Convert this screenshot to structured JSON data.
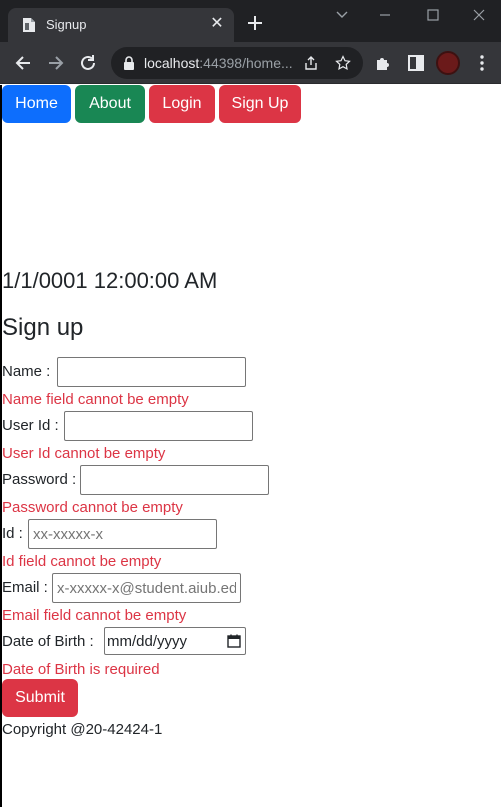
{
  "browser": {
    "tab_title": "Signup",
    "url_host": "localhost",
    "url_rest": ":44398/home..."
  },
  "nav": {
    "home": "Home",
    "about": "About",
    "login": "Login",
    "signup": "Sign Up"
  },
  "page": {
    "datetime": "1/1/0001 12:00:00 AM",
    "heading": "Sign up",
    "copyright": "Copyright @20-42424-1"
  },
  "form": {
    "name_label": "Name :",
    "name_value": "",
    "name_error": "Name field cannot be empty",
    "userid_label": "User Id :",
    "userid_value": "",
    "userid_error": "User Id cannot be empty",
    "password_label": "Password :",
    "password_value": "",
    "password_error": "Password cannot be empty",
    "id_label": "Id :",
    "id_placeholder": "xx-xxxxx-x",
    "id_error": "Id field cannot be empty",
    "email_label": "Email :",
    "email_placeholder": "x-xxxxx-x@student.aiub.edu",
    "email_error": "Email field cannot be empty",
    "dob_label": "Date of Birth :",
    "dob_placeholder": "mm/dd/yyyy",
    "dob_error": "Date of Birth is required",
    "submit": "Submit"
  },
  "colors": {
    "primary": "#0d6efd",
    "success": "#198754",
    "danger": "#dc3545"
  }
}
